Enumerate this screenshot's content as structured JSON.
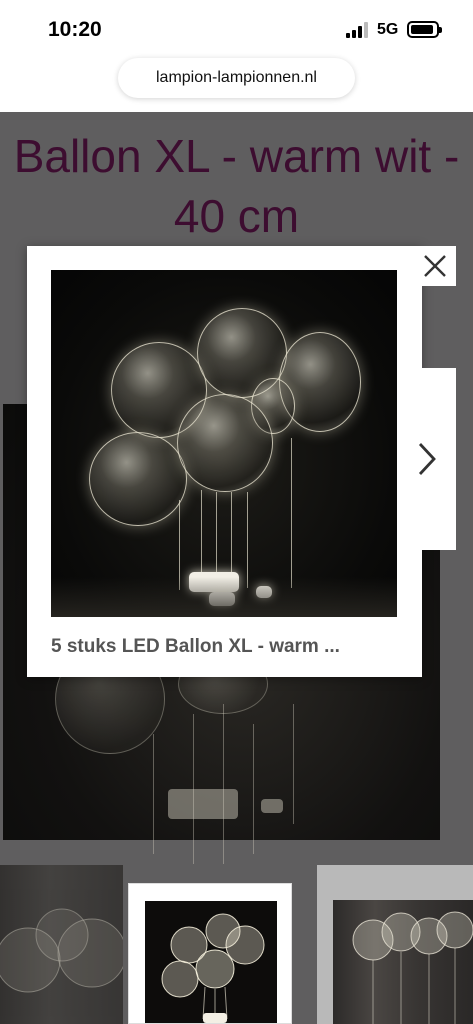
{
  "status_bar": {
    "time": "10:20",
    "network": "5G"
  },
  "browser": {
    "url": "lampion-lampionnen.nl"
  },
  "page": {
    "title": "Ballon XL - warm wit - 40 cm"
  },
  "lightbox": {
    "caption": "5 stuks LED Ballon XL - warm ..."
  },
  "icons": {
    "close": "close-icon",
    "next": "chevron-right-icon",
    "signal": "cellular-signal-icon",
    "battery": "battery-icon"
  },
  "colors": {
    "title": "#3d0d30",
    "overlay": "#5f5e5f",
    "caption": "#555555"
  }
}
